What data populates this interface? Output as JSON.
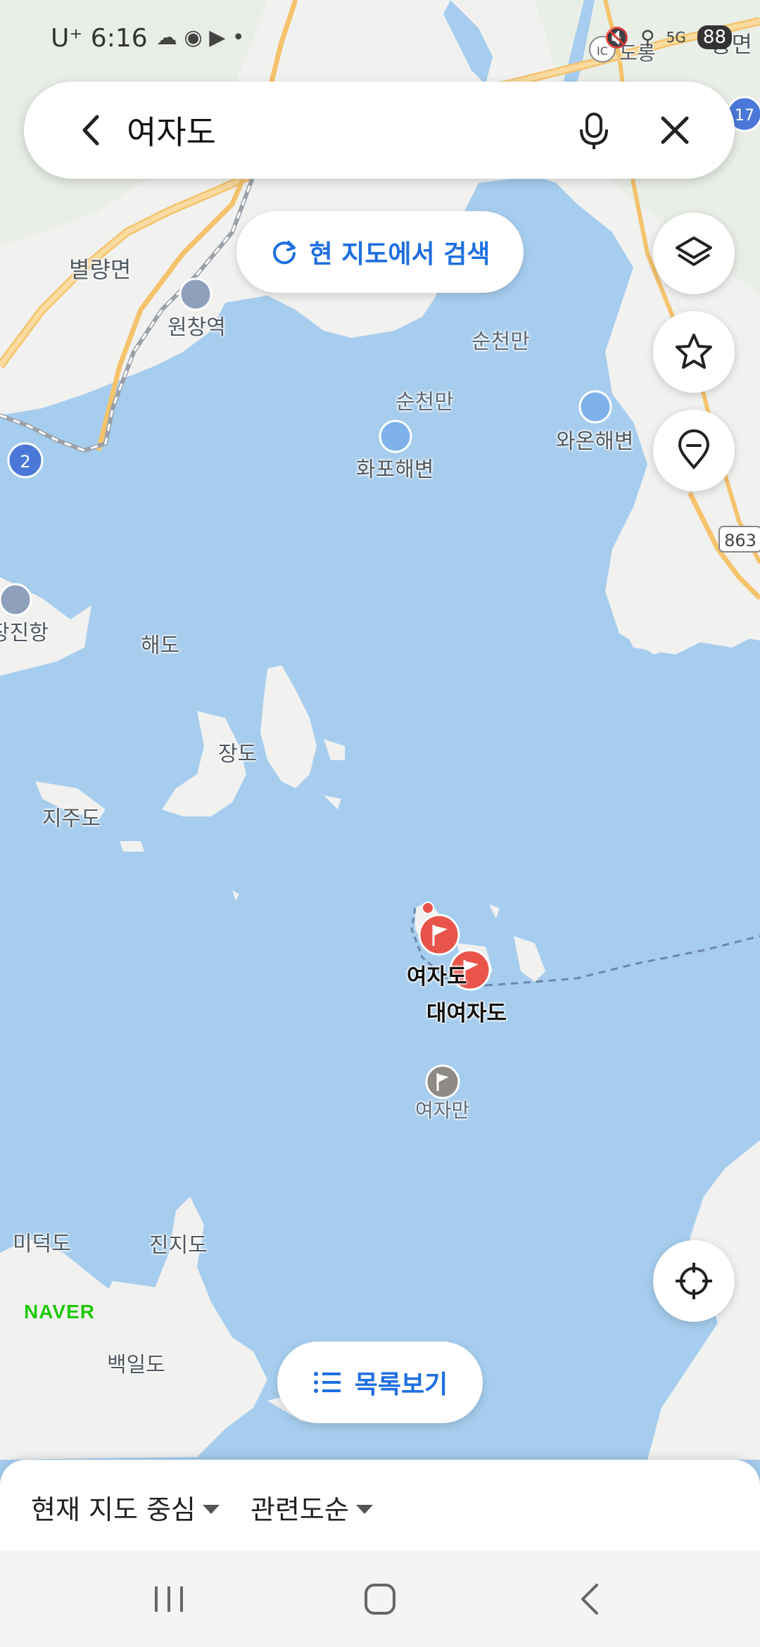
{
  "status_bar": {
    "time": "U⁺ 6:16",
    "left_icons": "☁ ◉ ▶ •",
    "right_text": "5G",
    "battery": "88"
  },
  "search": {
    "query": "여자도"
  },
  "search_here_label": "현 지도에서 검색",
  "list_view_label": "목록보기",
  "map_labels": {
    "byeolryang": "별량면",
    "wonchang_station": "원창역",
    "suncheonman_1": "순천만",
    "suncheonman_2": "순천만",
    "wahon_beach": "와온해변",
    "hwapo_beach": "화포해변",
    "jangjin_port": "장진항",
    "haedo": "해도",
    "jangdo": "장도",
    "jijudo": "지주도",
    "yeojado": "여자도",
    "daeyeojado": "대여자도",
    "yeojaman": "여자만",
    "mideokdo": "미덕도",
    "jinjido": "진지도",
    "baegildo": "백일도",
    "doryong": "도롱",
    "right_edge_top": "통면",
    "route_2": "2",
    "route_17": "17",
    "route_863": "863",
    "ic": "IC"
  },
  "naver_logo": "NAVER",
  "bottom_sheet": {
    "filter_center": "현재 지도 중심",
    "filter_sort": "관련도순"
  },
  "colors": {
    "sea": "#a6cdee",
    "land": "#f1f1f0",
    "accent_blue": "#1f6fe0",
    "marker_red": "#e8534a",
    "naver_green": "#1ec800"
  }
}
